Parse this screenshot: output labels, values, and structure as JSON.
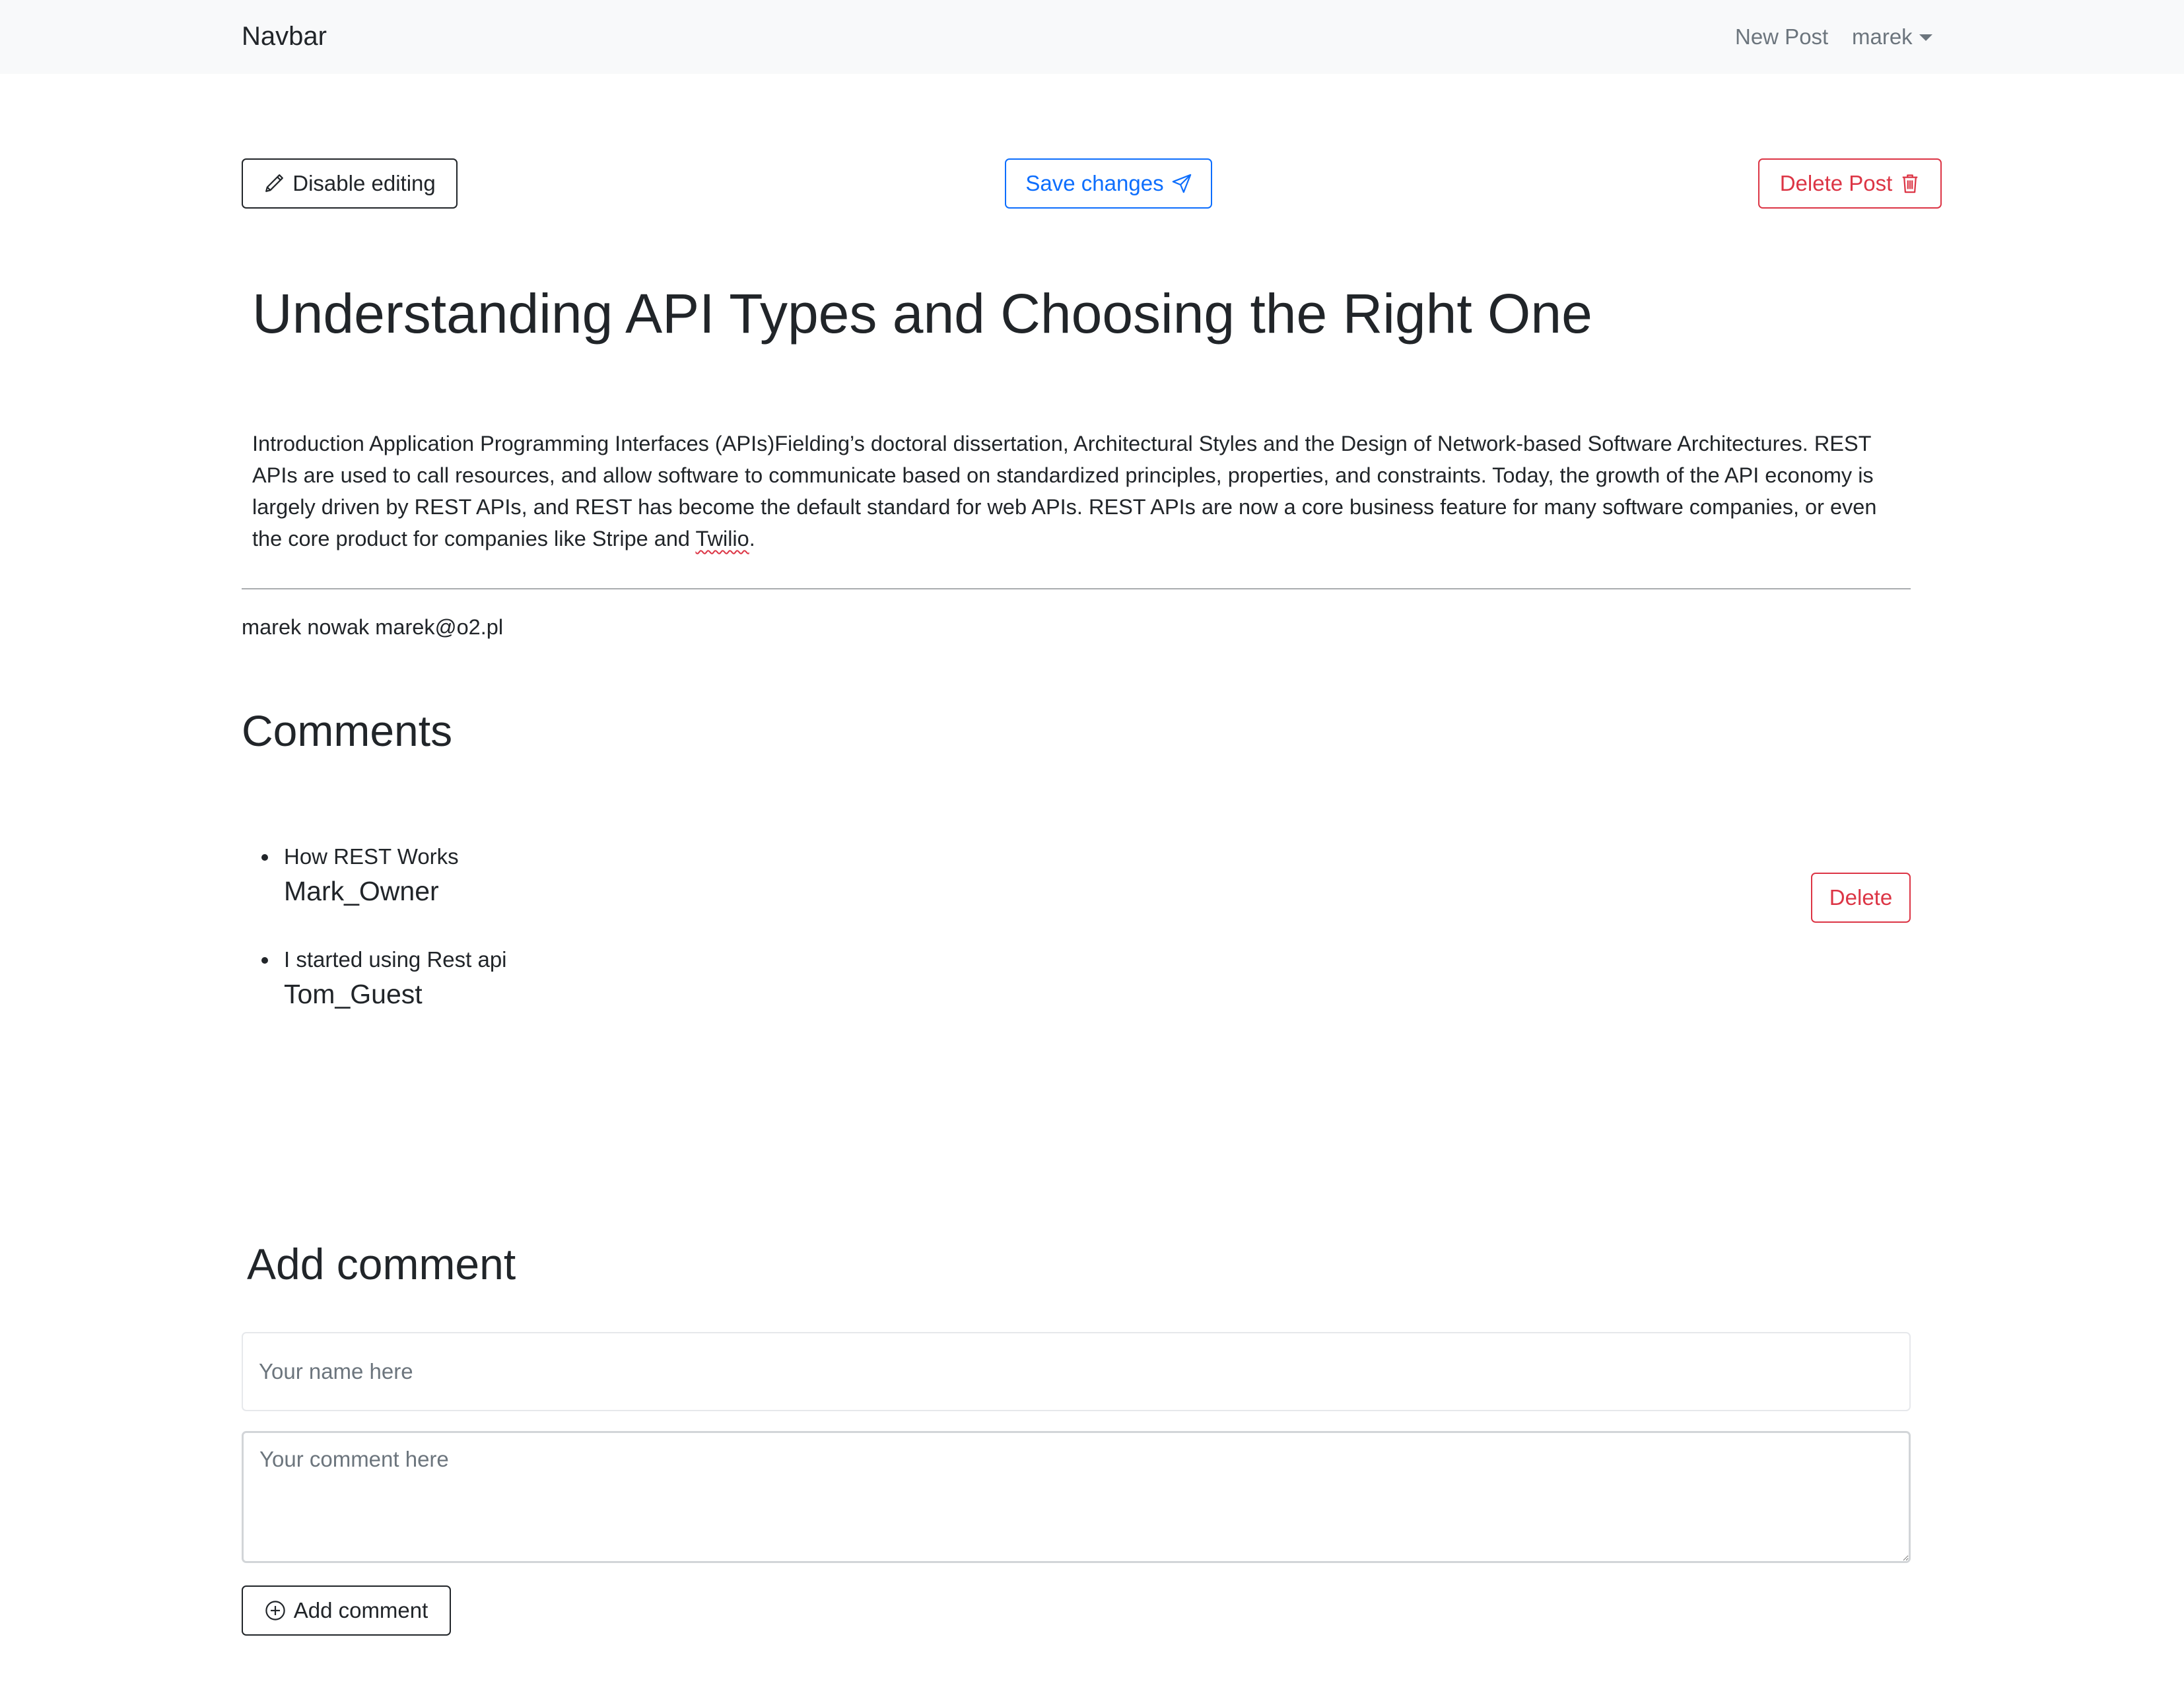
{
  "navbar": {
    "brand": "Navbar",
    "new_post": "New Post",
    "user": "marek"
  },
  "toolbar": {
    "disable_editing": "Disable editing",
    "save_changes": "Save changes",
    "delete_post": "Delete Post"
  },
  "post": {
    "title": "Understanding API Types and Choosing the Right One",
    "body_main": "Introduction Application Programming Interfaces (APIs)Fielding’s doctoral dissertation, Architectural Styles and the Design of Network-based Software Architectures. REST APIs are used to call resources, and allow software to communicate based on standardized principles, properties, and constraints. Today, the growth of the API economy is largely driven by REST APIs, and REST has become the default standard for web APIs. REST APIs are now a core business feature for many software companies, or even the core product for companies like Stripe and ",
    "body_link": "Twilio",
    "body_end": ".",
    "author": "marek nowak marek@o2.pl"
  },
  "comments": {
    "heading": "Comments",
    "items": [
      {
        "text": "How REST Works",
        "author": "Mark_Owner"
      },
      {
        "text": "I started using Rest api",
        "author": "Tom_Guest"
      }
    ],
    "delete_label": "Delete"
  },
  "add_comment": {
    "heading": "Add comment",
    "name_placeholder": "Your name here",
    "comment_placeholder": "Your comment here",
    "button_label": "Add comment"
  },
  "icons": {
    "disable_editing": "pencil-icon",
    "save_changes": "send-icon",
    "delete_post": "trash-icon",
    "add_comment": "plus-circle-icon",
    "user_menu": "caret-down-icon"
  },
  "colors": {
    "primary": "#0d6efd",
    "danger": "#dc3545",
    "dark": "#212529",
    "navbar_bg": "#f8f9fa",
    "muted": "#6c757d"
  }
}
